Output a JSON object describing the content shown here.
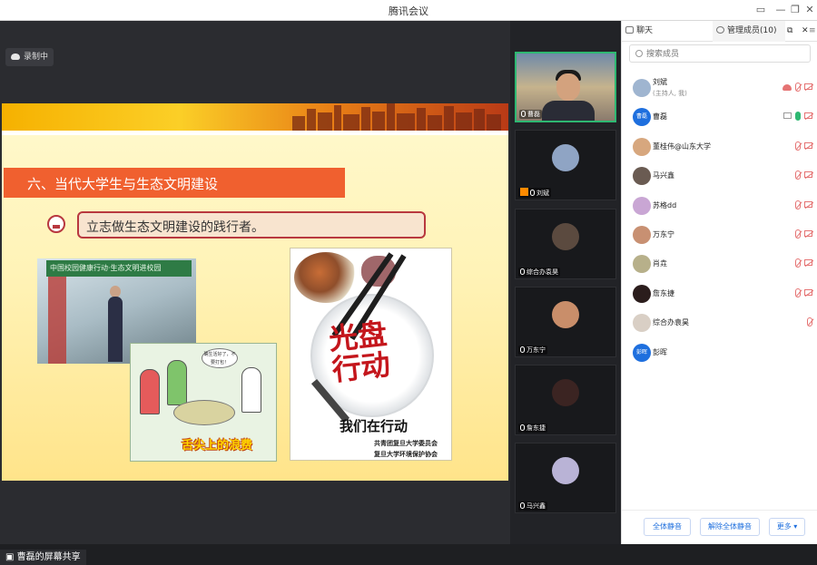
{
  "window": {
    "title": "腾讯会议",
    "controls": [
      "minimize-icon",
      "restore-icon",
      "close-icon"
    ]
  },
  "stage": {
    "recording_label": "录制中",
    "screen_share_label": "曹磊的屏幕共享",
    "slide": {
      "heading": "六、当代大学生与生态文明建设",
      "bullet": "立志做生态文明建设的践行者。",
      "photo_banner": "中国校园健康行动·生态文明进校园",
      "cartoon_bubble": "确生活好了，不要打包！",
      "cartoon_caption": "舌尖上的浪费",
      "poster_stamp_line1": "光盘",
      "poster_stamp_line2": "行动",
      "poster_slogan": "我们在行动",
      "poster_org1": "共青团复旦大学委员会",
      "poster_org2": "复旦大学环境保护协会"
    }
  },
  "video_strip": [
    {
      "name": "曹磊",
      "active": true,
      "video": true,
      "host": false
    },
    {
      "name": "刘斌",
      "active": false,
      "video": false,
      "host": true
    },
    {
      "name": "综合办袁昊",
      "active": false,
      "video": false,
      "host": false
    },
    {
      "name": "万东宁",
      "active": false,
      "video": false,
      "host": false
    },
    {
      "name": "詹东捷",
      "active": false,
      "video": false,
      "host": false
    },
    {
      "name": "马兴鑫",
      "active": false,
      "video": false,
      "host": false
    }
  ],
  "panel": {
    "tab_chat": "聊天",
    "tab_members": "管理成员(10)",
    "search_placeholder": "搜索成员",
    "members": [
      {
        "name": "刘斌",
        "sub": "(主持人, 我)",
        "avatar": "",
        "icons": [
          "cloud",
          "mic-off",
          "cam-off"
        ]
      },
      {
        "name": "曹磊",
        "sub": "",
        "avatar": "曹磊",
        "icons": [
          "screen",
          "mic-on",
          "cam-off"
        ]
      },
      {
        "name": "董桂伟@山东大学",
        "sub": "",
        "avatar": "",
        "icons": [
          "mic-off",
          "cam-off"
        ]
      },
      {
        "name": "马兴鑫",
        "sub": "",
        "avatar": "",
        "icons": [
          "mic-off",
          "cam-off"
        ]
      },
      {
        "name": "苏格dd",
        "sub": "",
        "avatar": "",
        "icons": [
          "mic-off",
          "cam-off"
        ]
      },
      {
        "name": "万东宁",
        "sub": "",
        "avatar": "",
        "icons": [
          "mic-off",
          "cam-off"
        ]
      },
      {
        "name": "肖垚",
        "sub": "",
        "avatar": "",
        "icons": [
          "mic-off",
          "cam-off"
        ]
      },
      {
        "name": "詹东捷",
        "sub": "",
        "avatar": "",
        "icons": [
          "mic-off",
          "cam-off"
        ]
      },
      {
        "name": "综合办袁昊",
        "sub": "",
        "avatar": "",
        "icons": [
          "mic-off"
        ]
      },
      {
        "name": "彭晖",
        "sub": "",
        "avatar": "彭晖",
        "icons": []
      }
    ],
    "buttons": {
      "mute_all": "全体静音",
      "unmute_all": "解除全体静音",
      "more": "更多 ▾"
    }
  },
  "colors": {
    "accent": "#1e6fde",
    "active_border": "#2eb872",
    "danger": "#e57373",
    "slide_heading_bg": "#f0602f"
  }
}
